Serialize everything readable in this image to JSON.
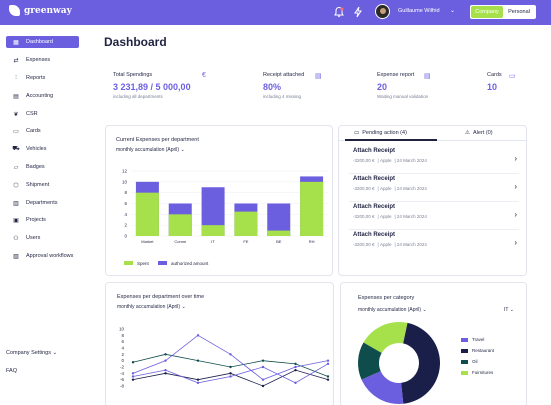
{
  "app": {
    "brand": "greenway"
  },
  "topbar": {
    "user_name": "Guillaume Wilfrid",
    "switch_company": "Company",
    "switch_personal": "Personal"
  },
  "sidebar": {
    "items": [
      {
        "label": "Dashboard",
        "icon": "grid-icon",
        "active": true
      },
      {
        "label": "Expenses",
        "icon": "arrows-icon"
      },
      {
        "label": "Reports",
        "icon": "report-icon"
      },
      {
        "label": "Accounting",
        "icon": "ledger-icon"
      },
      {
        "label": "CSR",
        "icon": "leaf-icon"
      },
      {
        "label": "Cards",
        "icon": "card-icon"
      },
      {
        "label": "Vehicles",
        "icon": "car-icon"
      },
      {
        "label": "Badges",
        "icon": "badge-icon"
      },
      {
        "label": "Shipment",
        "icon": "box-icon"
      },
      {
        "label": "Departments",
        "icon": "building-icon"
      },
      {
        "label": "Projects",
        "icon": "folder-icon"
      },
      {
        "label": "Users",
        "icon": "users-icon"
      },
      {
        "label": "Approval workflows",
        "icon": "workflow-icon"
      }
    ],
    "company_settings": "Company Settings",
    "faq": "FAQ"
  },
  "page": {
    "title": "Dashboard"
  },
  "kpis": [
    {
      "label": "Total Spendings",
      "value": "3 231,89 / 5 000,00",
      "sub": "including all departments"
    },
    {
      "label": "Receipt attached",
      "value": "80%",
      "sub": "including 4 missing"
    },
    {
      "label": "Expense report",
      "value": "20",
      "sub": "Waiting manual validation"
    },
    {
      "label": "Cards",
      "value": "10",
      "sub": ""
    }
  ],
  "current_expenses": {
    "title": "Current Expenses per department",
    "filter": "monthly accumulation (April)",
    "legend_spent": "Spent",
    "legend_authorized": "authorized amount"
  },
  "pending": {
    "tab_pending": "Pending action (4)",
    "tab_alert": "Alert (0)",
    "items": [
      {
        "title": "Attach Receipt",
        "amount": "-3200,00 €",
        "merchant": "Apple",
        "date": "24 March 2024"
      },
      {
        "title": "Attach Receipt",
        "amount": "-3200,00 €",
        "merchant": "Apple",
        "date": "24 March 2024"
      },
      {
        "title": "Attach Receipt",
        "amount": "-3200,00 €",
        "merchant": "Apple",
        "date": "24 March 2024"
      },
      {
        "title": "Attach Receipt",
        "amount": "-3200,00 €",
        "merchant": "Apple",
        "date": "24 March 2024"
      }
    ]
  },
  "over_time": {
    "title": "Expenses per department over time",
    "filter": "monthly accumulation (April)"
  },
  "per_category": {
    "title": "Expenses per category",
    "filter": "monthly accumulation (April)",
    "dept": "IT"
  },
  "colors": {
    "accent": "#6b5fe0",
    "green": "#a6e14b",
    "teal": "#0f4c4c",
    "navy": "#1a1f4a"
  },
  "chart_data": [
    {
      "type": "bar",
      "categories": [
        "Market",
        "Comm",
        "IT",
        "FE",
        "BE",
        "RH"
      ],
      "ylim": [
        0,
        12
      ],
      "yticks": [
        0,
        2,
        4,
        6,
        8,
        10,
        12
      ],
      "series": [
        {
          "name": "Spent",
          "values": [
            8,
            4,
            2,
            4.5,
            1,
            10
          ]
        },
        {
          "name": "authorized amount",
          "values": [
            10,
            6,
            9,
            6,
            6,
            11
          ]
        }
      ]
    },
    {
      "type": "line",
      "x": [
        1,
        2,
        3,
        4,
        5,
        6,
        7
      ],
      "ylim": [
        -8,
        10
      ],
      "yticks": [
        10,
        8,
        6,
        4,
        2,
        0,
        -2,
        -4,
        -6,
        -8
      ],
      "series": [
        {
          "values": [
            -0.5,
            2,
            0,
            -2,
            0,
            -1,
            -5
          ]
        },
        {
          "values": [
            -4,
            0,
            8,
            2,
            -6,
            -2,
            0
          ]
        },
        {
          "values": [
            -6,
            -4,
            -6,
            -4,
            -8,
            -3,
            -6
          ]
        },
        {
          "values": [
            -5,
            -3,
            -7,
            -5,
            -2,
            -7,
            -1
          ]
        }
      ]
    },
    {
      "type": "pie",
      "labels": [
        "Travel",
        "Restaurant",
        "Oil",
        "Fuirnitures"
      ],
      "values": [
        20,
        45,
        15,
        20
      ]
    }
  ]
}
